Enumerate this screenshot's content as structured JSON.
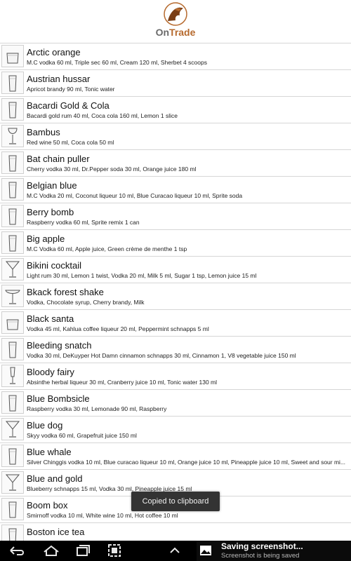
{
  "app": {
    "brand_prefix": "On",
    "brand_suffix": "Trade"
  },
  "cocktails": [
    {
      "name": "Arctic orange",
      "ingredients": "M.C vodka 60 ml, Triple sec 60 ml, Cream 120 ml, Sherbet 4 scoops",
      "glass": "rocks-glass-icon"
    },
    {
      "name": "Austrian hussar",
      "ingredients": "Apricot brandy 90 ml, Tonic water",
      "glass": "highball-glass-icon"
    },
    {
      "name": "Bacardi Gold & Cola",
      "ingredients": "Bacardi gold rum 40 ml, Coca cola 160 ml, Lemon 1 slice",
      "glass": "highball-glass-icon"
    },
    {
      "name": "Bambus",
      "ingredients": "Red wine 50 ml, Coca cola 50 ml",
      "glass": "wine-glass-icon"
    },
    {
      "name": "Bat chain puller",
      "ingredients": "Cherry vodka 30 ml, Dr.Pepper soda 30 ml, Orange juice 180 ml",
      "glass": "highball-glass-icon"
    },
    {
      "name": "Belgian blue",
      "ingredients": "M.C Vodka 20 ml, Coconut liqueur 10 ml, Blue Curacao liqueur 10 ml, Sprite soda",
      "glass": "highball-glass-icon"
    },
    {
      "name": "Berry bomb",
      "ingredients": "Raspberry vodka 60 ml, Sprite remix 1 can",
      "glass": "highball-glass-icon"
    },
    {
      "name": "Big apple",
      "ingredients": "M.C Vodka 60 ml, Apple juice, Green crème de menthe 1 tsp",
      "glass": "highball-glass-icon"
    },
    {
      "name": "Bikini cocktail",
      "ingredients": "Light rum 30 ml, Lemon 1 twist, Vodka 20 ml, Milk 5 ml, Sugar 1 tsp, Lemon juice 15 ml",
      "glass": "martini-glass-icon"
    },
    {
      "name": "Bkack forest shake",
      "ingredients": "Vodka, Chocolate syrup, Cherry brandy, Milk",
      "glass": "coupe-glass-icon"
    },
    {
      "name": "Black santa",
      "ingredients": "Vodka 45 ml, Kahlua coffee liqueur 20 ml, Peppermint schnapps 5 ml",
      "glass": "rocks-glass-icon"
    },
    {
      "name": "Bleeding snatch",
      "ingredients": "Vodka 30 ml, DeKuyper Hot Damn cinnamon schnapps 30 ml, Cinnamon 1, V8 vegetable juice 150 ml",
      "glass": "highball-glass-icon"
    },
    {
      "name": "Bloody fairy",
      "ingredients": "Absinthe herbal liqueur 30 ml, Cranberry juice 10 ml, Tonic water 130 ml",
      "glass": "flute-glass-icon"
    },
    {
      "name": "Blue Bombsicle",
      "ingredients": "Raspberry vodka 30 ml, Lemonade 90 ml, Raspberry",
      "glass": "highball-glass-icon"
    },
    {
      "name": "Blue dog",
      "ingredients": "Skyy vodka 60 ml, Grapefruit juice 150 ml",
      "glass": "martini-glass-icon"
    },
    {
      "name": "Blue whale",
      "ingredients": "Silver Chinggis vodka 10 ml, Blue curacao liqueur 10 ml, Orange juice 10 ml, Pineapple juice 10 ml, Sweet and sour mi...",
      "glass": "highball-glass-icon"
    },
    {
      "name": "Blue and gold",
      "ingredients": "Blueberry schnapps 15 ml, Vodka 30 ml, Pineapple juice 15 ml",
      "glass": "martini-glass-icon"
    },
    {
      "name": "Boom box",
      "ingredients": "Smirnoff vodka 10 ml, White wine 10 ml, Hot coffee 10 ml",
      "glass": "highball-glass-icon"
    },
    {
      "name": "Boston ice tea",
      "ingredients": "",
      "glass": "highball-glass-icon"
    }
  ],
  "toast": {
    "text": "Copied to clipboard"
  },
  "notification": {
    "title": "Saving screenshot...",
    "subtitle": "Screenshot is being saved"
  }
}
